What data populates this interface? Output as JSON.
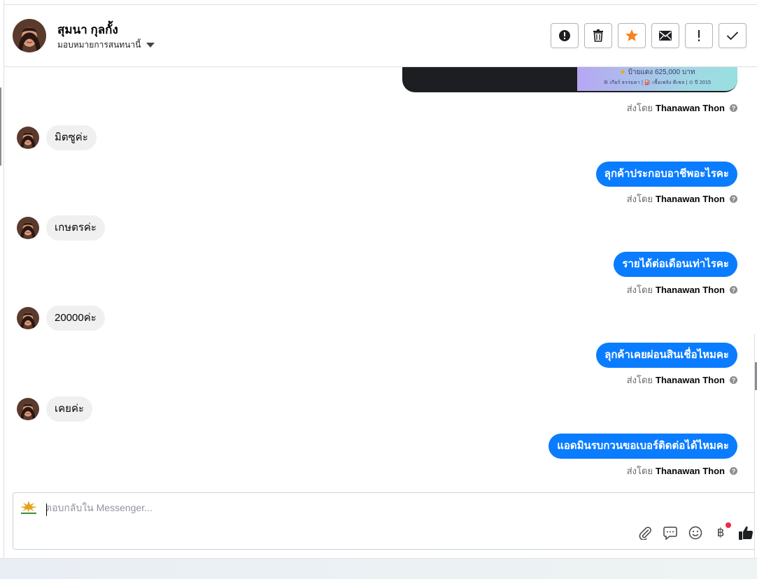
{
  "header": {
    "name": "สุมนา กุลกั้ง",
    "assign_label": "มอบหมายการสนทนานี้",
    "actions": [
      "alert",
      "delete",
      "star",
      "mail",
      "important",
      "done"
    ]
  },
  "attachment": {
    "price": "ป้ายแดง 625,000 บาท",
    "meta": "⚙ เกียร์ ธรรมดา | ⛽ เชื้อเพลิง ดีเซล | ⊙ ปี 2015"
  },
  "sent_by": {
    "prefix": "ส่งโดย",
    "agent": "Thanawan Thon"
  },
  "messages": [
    {
      "direction": "in",
      "text": "มิตซูค่ะ"
    },
    {
      "direction": "out",
      "text": "ลุกค้าประกอบอาชีพอะไรคะ"
    },
    {
      "direction": "in",
      "text": "เกษตรค่ะ"
    },
    {
      "direction": "out",
      "text": "รายได้ต่อเดือนเท่าไรคะ"
    },
    {
      "direction": "in",
      "text": "20000ค่ะ"
    },
    {
      "direction": "out",
      "text": "ลุกค้าเคยผ่อนสินเชื่อไหมคะ"
    },
    {
      "direction": "in",
      "text": "เคยค่ะ"
    },
    {
      "direction": "out",
      "text": "แอดมินรบกวนขอเบอร์ติดต่อได้ไหมคะ"
    }
  ],
  "composer": {
    "placeholder": "ตอบกลับใน Messenger...",
    "tools": [
      "paperclip",
      "chat-bubble",
      "emoji",
      "baht",
      "thumbs-up"
    ]
  },
  "colors": {
    "outgoing_bubble": "#0a7cff",
    "incoming_bubble": "#f0f0f0",
    "star": "#f5831f",
    "notification_dot": "#f02849"
  }
}
